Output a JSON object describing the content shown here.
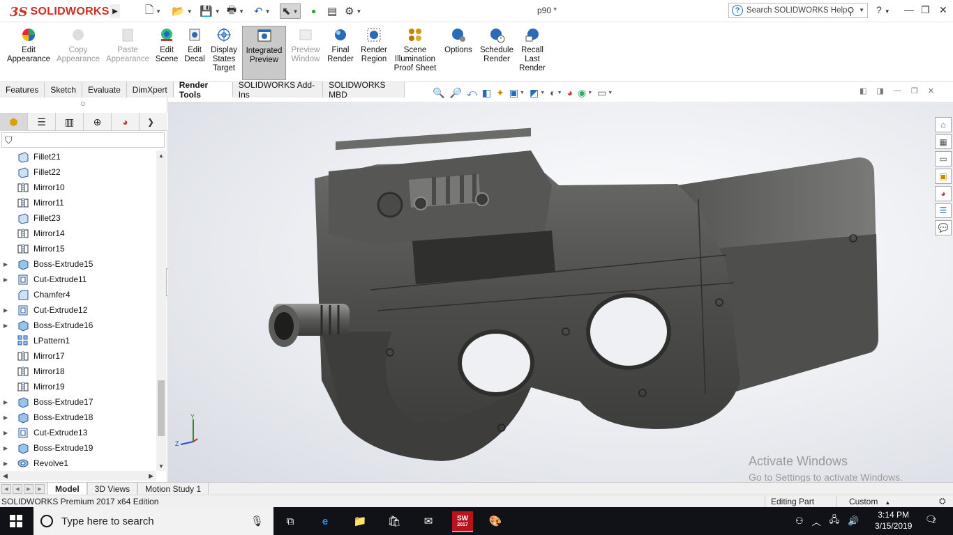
{
  "app": {
    "brand_ds": "3S",
    "brand_name": "SOLIDWORKS",
    "doc_title": "p90 *",
    "help_search_placeholder": "Search SOLIDWORKS Help"
  },
  "ribbon": {
    "edit_appearance": [
      "Edit",
      "Appearance"
    ],
    "copy_appearance": [
      "Copy",
      "Appearance"
    ],
    "paste_appearance": [
      "Paste",
      "Appearance"
    ],
    "edit_scene": [
      "Edit",
      "Scene"
    ],
    "edit_decal": [
      "Edit",
      "Decal"
    ],
    "display_states_target": [
      "Display",
      "States",
      "Target"
    ],
    "integrated_preview": [
      "Integrated",
      "Preview"
    ],
    "preview_window": [
      "Preview",
      "Window"
    ],
    "final_render": [
      "Final",
      "Render"
    ],
    "render_region": [
      "Render",
      "Region"
    ],
    "scene_illumination": [
      "Scene",
      "Illumination",
      "Proof Sheet"
    ],
    "options": [
      "Options"
    ],
    "schedule_render": [
      "Schedule",
      "Render"
    ],
    "recall_last_render": [
      "Recall",
      "Last",
      "Render"
    ]
  },
  "tabs": [
    "Features",
    "Sketch",
    "Evaluate",
    "DimXpert",
    "Render Tools",
    "SOLIDWORKS Add-Ins",
    "SOLIDWORKS MBD"
  ],
  "active_tab": "Render Tools",
  "tree": [
    {
      "label": "Fillet21",
      "icon": "fillet-icon",
      "expandable": false
    },
    {
      "label": "Fillet22",
      "icon": "fillet-icon",
      "expandable": false
    },
    {
      "label": "Mirror10",
      "icon": "mirror-icon",
      "expandable": false
    },
    {
      "label": "Mirror11",
      "icon": "mirror-icon",
      "expandable": false
    },
    {
      "label": "Fillet23",
      "icon": "fillet-icon",
      "expandable": false
    },
    {
      "label": "Mirror14",
      "icon": "mirror-icon",
      "expandable": false
    },
    {
      "label": "Mirror15",
      "icon": "mirror-icon",
      "expandable": false
    },
    {
      "label": "Boss-Extrude15",
      "icon": "boss-extrude-icon",
      "expandable": true
    },
    {
      "label": "Cut-Extrude11",
      "icon": "cut-extrude-icon",
      "expandable": true
    },
    {
      "label": "Chamfer4",
      "icon": "chamfer-icon",
      "expandable": false
    },
    {
      "label": "Cut-Extrude12",
      "icon": "cut-extrude-icon",
      "expandable": true
    },
    {
      "label": "Boss-Extrude16",
      "icon": "boss-extrude-icon",
      "expandable": true
    },
    {
      "label": "LPattern1",
      "icon": "linear-pattern-icon",
      "expandable": false
    },
    {
      "label": "Mirror17",
      "icon": "mirror-icon",
      "expandable": false
    },
    {
      "label": "Mirror18",
      "icon": "mirror-icon",
      "expandable": false
    },
    {
      "label": "Mirror19",
      "icon": "mirror-icon",
      "expandable": false
    },
    {
      "label": "Boss-Extrude17",
      "icon": "boss-extrude-icon",
      "expandable": true
    },
    {
      "label": "Boss-Extrude18",
      "icon": "boss-extrude-icon",
      "expandable": true
    },
    {
      "label": "Cut-Extrude13",
      "icon": "cut-extrude-icon",
      "expandable": true
    },
    {
      "label": "Boss-Extrude19",
      "icon": "boss-extrude-icon",
      "expandable": true
    },
    {
      "label": "Revolve1",
      "icon": "revolve-icon",
      "expandable": true
    }
  ],
  "triad": {
    "y": "Y",
    "z": "Z"
  },
  "watermark": {
    "line1": "Activate Windows",
    "line2": "Go to Settings to activate Windows."
  },
  "model_tabs": [
    "Model",
    "3D Views",
    "Motion Study 1"
  ],
  "status": {
    "edition": "SOLIDWORKS Premium 2017 x64 Edition",
    "mode": "Editing Part",
    "units": "Custom"
  },
  "taskbar": {
    "search_placeholder": "Type here to search",
    "time": "3:14 PM",
    "date": "3/15/2019",
    "notifications": "2",
    "sw_badge": "2017"
  },
  "colors": {
    "brand": "#d52b1e",
    "gun_body": "#4a4b49",
    "taskbar": "#101218"
  }
}
